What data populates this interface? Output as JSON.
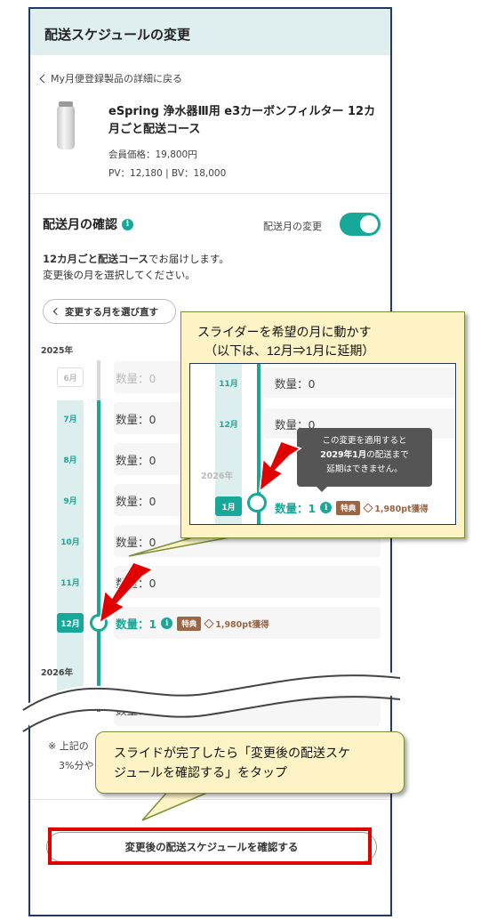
{
  "header": {
    "title": "配送スケジュールの変更"
  },
  "back_link": {
    "label": "My月便登録製品の詳細に戻る"
  },
  "product": {
    "name": "eSpring 浄水器Ⅲ用 e3カーボンフィルター 12カ月ごと配送コース",
    "price": "会員価格：19,800円",
    "pv_bv": "PV：12,180 | BV：18,000"
  },
  "section": {
    "title": "配送月の確認",
    "toggle_label": "配送月の変更",
    "toggle_on": true,
    "desc_bold": "12カ月ごと配送コース",
    "desc_rest": "でお届けします。",
    "desc_line2": "変更後の月を選択してください。",
    "reselect_label": "変更する月を選び直す"
  },
  "schedule": {
    "year1": "2025年",
    "year2": "2026年",
    "rows": [
      {
        "month": "6月",
        "qty": "数量：0",
        "state": "past"
      },
      {
        "month": "7月",
        "qty": "数量：0",
        "state": "normal"
      },
      {
        "month": "8月",
        "qty": "数量：0",
        "state": "normal"
      },
      {
        "month": "9月",
        "qty": "数量：0",
        "state": "normal"
      },
      {
        "month": "10月",
        "qty": "数量：0",
        "state": "normal"
      },
      {
        "month": "11月",
        "qty": "数量：0",
        "state": "normal"
      },
      {
        "month": "12月",
        "qty": "数量：1",
        "state": "active"
      }
    ],
    "bottom_qty": "数量：0",
    "badge": "特典",
    "points": "1,980pt獲得"
  },
  "note": {
    "line1": "※ 上記の",
    "line2": "3%分や"
  },
  "confirm_button": {
    "label": "変更後の配送スケジュールを確認する"
  },
  "callout1": {
    "line1": "スライダーを希望の月に動かす",
    "line2": "（以下は、12月⇒1月に延期）"
  },
  "inset": {
    "rows": [
      {
        "month": "11月",
        "qty": "数量：0"
      },
      {
        "month": "12月",
        "qty": "数量：0"
      }
    ],
    "year": "2026年",
    "active_month": "1月",
    "active_qty": "数量：1",
    "badge": "特典",
    "points": "1,980pt獲得",
    "tooltip_line1": "この変更を適用すると",
    "tooltip_bold": "2029年1月",
    "tooltip_line2_rest": "の配送まで",
    "tooltip_line3": "延期はできません。"
  },
  "callout2": {
    "line1": "スライドが完了したら「変更後の配送スケ",
    "line2": "ジュールを確認する」をタップ"
  },
  "colors": {
    "accent": "#17a89a",
    "header_bg": "#dfeeee",
    "badge": "#9c6644",
    "highlight": "#e00000",
    "callout_bg": "#fdf3c4"
  }
}
